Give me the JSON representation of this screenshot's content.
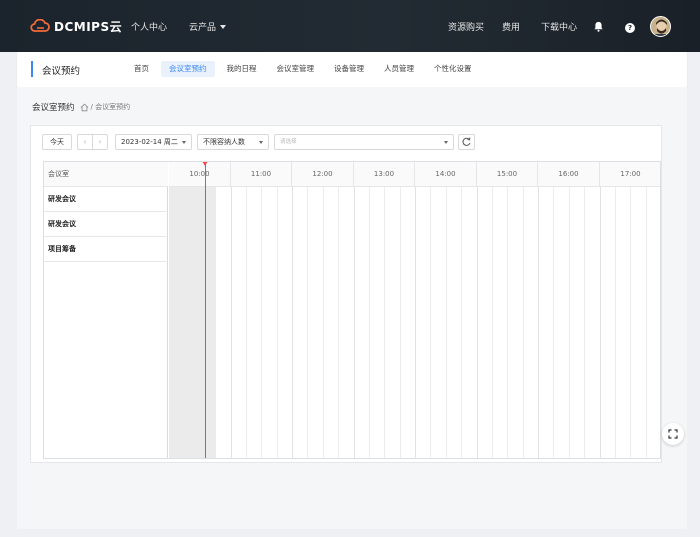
{
  "brand": {
    "logo_text": "DCMIPS云",
    "accent": "#3a87f2",
    "logo_accent": "#f26b3a"
  },
  "topnav": {
    "personal_center": "个人中心",
    "cloud_products": "云产品",
    "resource_purchase": "资源购买",
    "fees": "费用",
    "download_center": "下载中心",
    "help_glyph": "?"
  },
  "icons": [
    "bell-icon",
    "help-icon",
    "avatar",
    "home-icon",
    "refresh-icon",
    "fullscreen-icon"
  ],
  "module": {
    "title": "会议预约",
    "tabs": [
      {
        "label": "首页",
        "active": false
      },
      {
        "label": "会议室预约",
        "active": true
      },
      {
        "label": "我的日程",
        "active": false
      },
      {
        "label": "会议室管理",
        "active": false
      },
      {
        "label": "设备管理",
        "active": false
      },
      {
        "label": "人员管理",
        "active": false
      },
      {
        "label": "个性化设置",
        "active": false
      }
    ]
  },
  "breadcrumb": {
    "main": "会议室预约",
    "sub": "/ 会议室预约"
  },
  "toolbar": {
    "today": "今天",
    "prev": "‹",
    "next": "›",
    "date": "2023-02-14 周二",
    "capacity": "不限容纳人数",
    "room_placeholder": "请选择"
  },
  "grid": {
    "room_header": "会议室",
    "rooms": [
      "研发会议",
      "研发会议",
      "项目筹备"
    ],
    "hours": [
      "10:00",
      "11:00",
      "12:00",
      "13:00",
      "14:00",
      "15:00",
      "16:00",
      "17:00"
    ]
  }
}
